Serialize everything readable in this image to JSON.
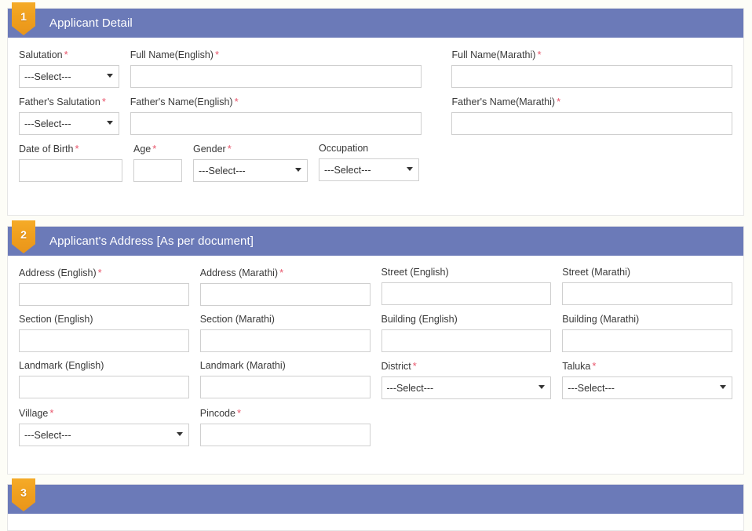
{
  "colors": {
    "header_bar": "#6b7ab8",
    "badge_orange": "#f0a01e",
    "required_asterisk": "#e8546a",
    "panel_background": "#ffffff",
    "page_background": "#fdfdf7"
  },
  "select_placeholder": "---Select---",
  "required_marker": "*",
  "sections": [
    {
      "number": "1",
      "title": "Applicant Detail",
      "rows": [
        [
          {
            "label": "Salutation",
            "required": true,
            "type": "select",
            "value": "---Select---",
            "name": "salutation"
          },
          {
            "label": "Full Name(English)",
            "required": true,
            "type": "text",
            "value": "",
            "name": "full-name-english"
          },
          {
            "label": "Full Name(Marathi)",
            "required": true,
            "type": "text",
            "value": "",
            "name": "full-name-marathi"
          }
        ],
        [
          {
            "label": "Father's Salutation",
            "required": true,
            "type": "select",
            "value": "---Select---",
            "name": "fathers-salutation"
          },
          {
            "label": "Father's Name(English)",
            "required": true,
            "type": "text",
            "value": "",
            "name": "fathers-name-english"
          },
          {
            "label": "Father's Name(Marathi)",
            "required": true,
            "type": "text",
            "value": "",
            "name": "fathers-name-marathi"
          }
        ],
        [
          {
            "label": "Date of Birth",
            "required": true,
            "type": "text",
            "value": "",
            "name": "date-of-birth"
          },
          {
            "label": "Age",
            "required": true,
            "type": "text",
            "value": "",
            "name": "age"
          },
          {
            "label": "Gender",
            "required": true,
            "type": "select",
            "value": "---Select---",
            "name": "gender"
          },
          {
            "label": "Occupation",
            "required": false,
            "type": "select",
            "value": "---Select---",
            "name": "occupation"
          }
        ]
      ]
    },
    {
      "number": "2",
      "title": "Applicant's Address [As per document]",
      "rows": [
        [
          {
            "label": "Address (English)",
            "required": true,
            "type": "text",
            "value": "",
            "name": "address-english"
          },
          {
            "label": "Address (Marathi)",
            "required": true,
            "type": "text",
            "value": "",
            "name": "address-marathi"
          },
          {
            "label": "Street (English)",
            "required": false,
            "type": "text",
            "value": "",
            "name": "street-english"
          },
          {
            "label": "Street (Marathi)",
            "required": false,
            "type": "text",
            "value": "",
            "name": "street-marathi"
          }
        ],
        [
          {
            "label": "Section (English)",
            "required": false,
            "type": "text",
            "value": "",
            "name": "section-english"
          },
          {
            "label": "Section (Marathi)",
            "required": false,
            "type": "text",
            "value": "",
            "name": "section-marathi"
          },
          {
            "label": "Building (English)",
            "required": false,
            "type": "text",
            "value": "",
            "name": "building-english"
          },
          {
            "label": "Building (Marathi)",
            "required": false,
            "type": "text",
            "value": "",
            "name": "building-marathi"
          }
        ],
        [
          {
            "label": "Landmark (English)",
            "required": false,
            "type": "text",
            "value": "",
            "name": "landmark-english"
          },
          {
            "label": "Landmark (Marathi)",
            "required": false,
            "type": "text",
            "value": "",
            "name": "landmark-marathi"
          },
          {
            "label": "District",
            "required": true,
            "type": "select",
            "value": "---Select---",
            "name": "district"
          },
          {
            "label": "Taluka",
            "required": true,
            "type": "select",
            "value": "---Select---",
            "name": "taluka"
          }
        ],
        [
          {
            "label": "Village",
            "required": true,
            "type": "select",
            "value": "---Select---",
            "name": "village"
          },
          {
            "label": "Pincode",
            "required": true,
            "type": "text",
            "value": "",
            "name": "pincode"
          }
        ]
      ]
    },
    {
      "number": "3",
      "title": "",
      "rows": []
    }
  ]
}
